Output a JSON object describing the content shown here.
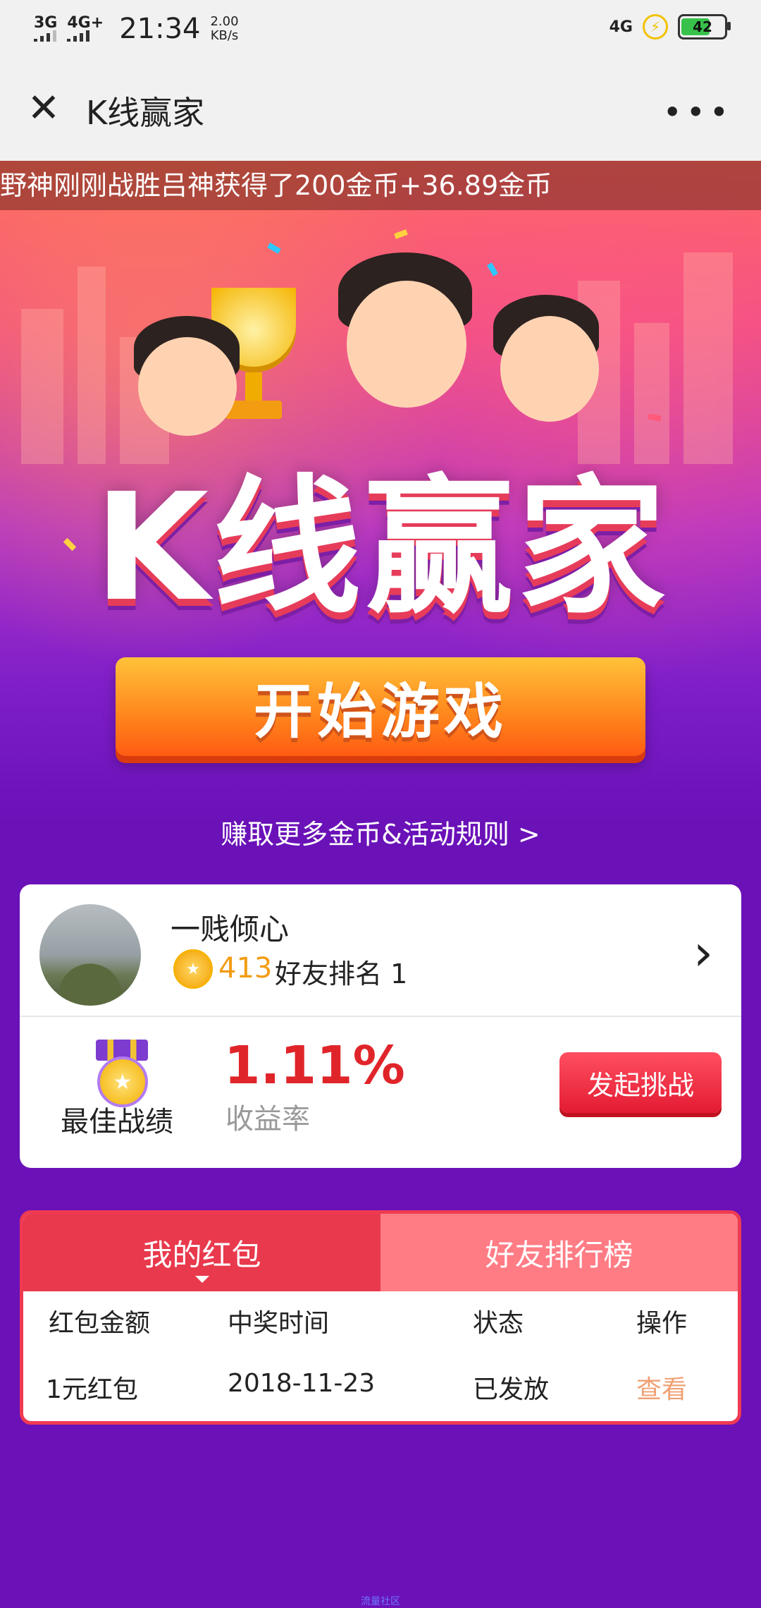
{
  "status_bar": {
    "network_left": "3G",
    "network_left2": "4G+",
    "time": "21:34",
    "speed_value": "2.00",
    "speed_unit": "KB/s",
    "network_right": "4G",
    "battery": "42"
  },
  "titlebar": {
    "title": "K线赢家",
    "close_icon": "close-icon",
    "more_icon": "more-icon"
  },
  "hero": {
    "ticker": "野神刚刚战胜吕神获得了200金币+36.89金币",
    "logo_text": "K线赢家",
    "start_button": "开始游戏",
    "rules_link": "赚取更多金币&活动规则 >"
  },
  "profile": {
    "name": "一贱倾心",
    "coins": "413",
    "rank": "好友排名 1",
    "best_label": "最佳战绩",
    "rate": "1.11%",
    "rate_label": "收益率",
    "challenge_button": "发起挑战"
  },
  "redpacket": {
    "tabs": [
      {
        "label": "我的红包",
        "active": true
      },
      {
        "label": "好友排行榜",
        "active": false
      }
    ],
    "headers": [
      "红包金额",
      "中奖时间",
      "状态",
      "操作"
    ],
    "rows": [
      [
        "1元红包",
        "2018-11-23",
        "已发放",
        "查看"
      ]
    ]
  },
  "footer": {
    "watermark": "流量社区"
  },
  "colors": {
    "background": "#6a11b8",
    "accent_red": "#e9394d",
    "coin_orange": "#f39c12",
    "rate_red": "#e0252a"
  }
}
